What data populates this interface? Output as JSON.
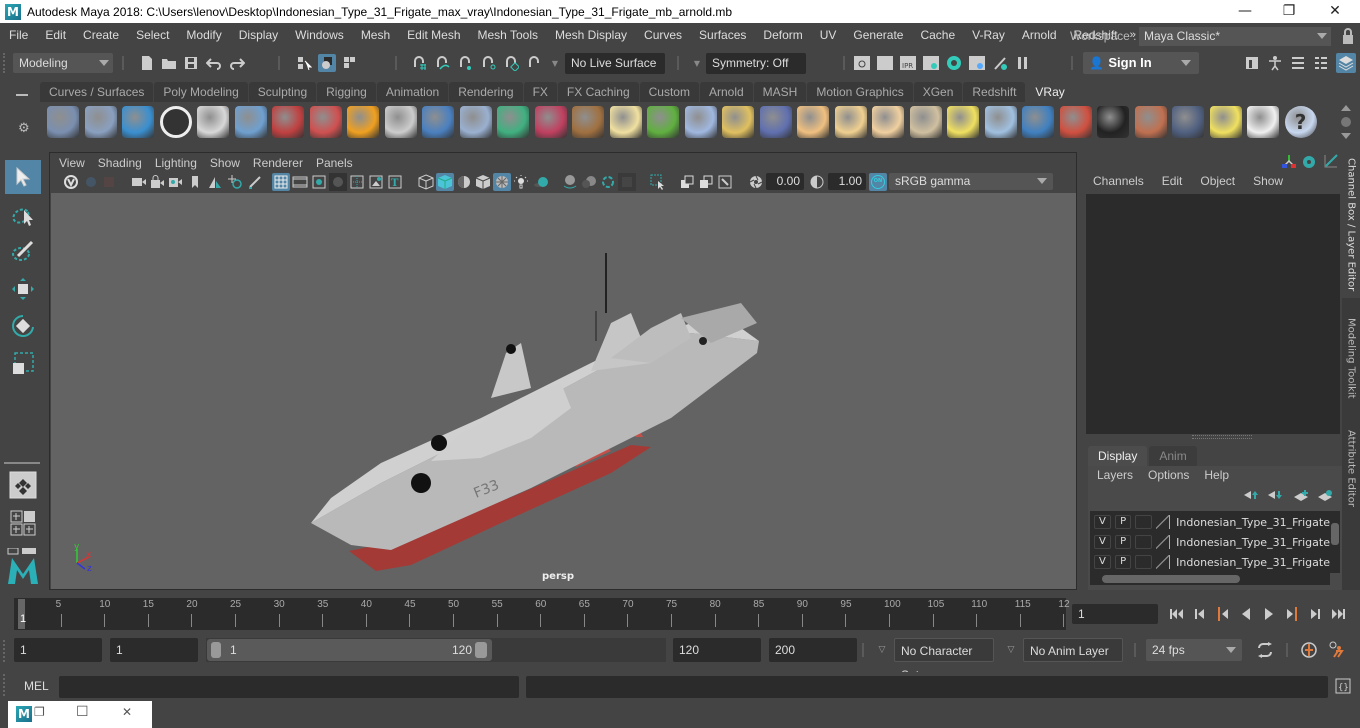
{
  "window": {
    "title": "Autodesk Maya 2018: C:\\Users\\lenov\\Desktop\\Indonesian_Type_31_Frigate_max_vray\\Indonesian_Type_31_Frigate_mb_arnold.mb",
    "logo": "M",
    "minimize": "—",
    "maximize": "❐",
    "close": "✕"
  },
  "menubar": {
    "items": [
      "File",
      "Edit",
      "Create",
      "Select",
      "Modify",
      "Display",
      "Windows",
      "Mesh",
      "Edit Mesh",
      "Mesh Tools",
      "Mesh Display",
      "Curves",
      "Surfaces",
      "Deform",
      "UV",
      "Generate",
      "Cache",
      "V-Ray",
      "Arnold",
      "Redshift"
    ],
    "overflow": "»",
    "workspace_label": "Workspace :",
    "workspace_value": "Maya Classic*"
  },
  "statusline": {
    "menuset": "Modeling",
    "live_surface": "No Live Surface",
    "symmetry": "Symmetry: Off",
    "sign_in": "Sign In"
  },
  "shelf": {
    "tabs": [
      "Curves / Surfaces",
      "Poly Modeling",
      "Sculpting",
      "Rigging",
      "Animation",
      "Rendering",
      "FX",
      "FX Caching",
      "Custom",
      "Arnold",
      "MASH",
      "Motion Graphics",
      "XGen",
      "Redshift",
      "VRay"
    ],
    "active_tab": "VRay",
    "icons": [
      "vray-export-icon",
      "vray-import-icon",
      "vray-proxy-list-icon",
      "vray-logo-icon",
      "vray-settings-doc-icon",
      "vray-dome-icon",
      "vray-camera-icon",
      "vray-material-spheres-icon",
      "vray-fire-icon",
      "vray-mesh-light-icon",
      "vray-rect-light-icon",
      "vray-cone-icon",
      "vray-volume-icon",
      "vray-fur-icon",
      "vray-texture-icon",
      "vray-sphere-grid-icon",
      "vray-grass-icon",
      "vray-scatter-icon",
      "vray-curve-icon",
      "vray-globe-icon",
      "vray-dome-light-icon",
      "vray-spot-light-icon",
      "vray-omni-light-icon",
      "vray-ies-light-icon",
      "vray-sun-icon",
      "vray-plane-icon",
      "vray-sphere-icon",
      "vray-multi-material-icon",
      "vray-checker-icon",
      "vray-frame-buffer-icon",
      "vray-settings-panel-icon",
      "vray-light-lister-icon",
      "vray-cloud-icon",
      "help-icon"
    ]
  },
  "panel": {
    "menus": [
      "View",
      "Shading",
      "Lighting",
      "Show",
      "Renderer",
      "Panels"
    ],
    "exposure": "0.00",
    "gamma": "1.00",
    "color_mgmt_badge": "ON",
    "color_space": "sRGB gamma",
    "camera_label": "persp",
    "ship_hull_number": "F33",
    "axis": {
      "x": "x",
      "y": "y",
      "z": "z"
    }
  },
  "channelbox": {
    "menus": [
      "Channels",
      "Edit",
      "Object",
      "Show"
    ],
    "layer_tabs": [
      "Display",
      "Anim"
    ],
    "layer_menus": [
      "Layers",
      "Options",
      "Help"
    ],
    "layers": [
      {
        "v": "V",
        "p": "P",
        "name": "Indonesian_Type_31_Frigate"
      },
      {
        "v": "V",
        "p": "P",
        "name": "Indonesian_Type_31_Frigate"
      },
      {
        "v": "V",
        "p": "P",
        "name": "Indonesian_Type_31_Frigate"
      }
    ]
  },
  "sidetabs": [
    "Channel Box / Layer Editor",
    "Modeling Toolkit",
    "Attribute Editor"
  ],
  "timeslider": {
    "ticks": [
      5,
      10,
      15,
      20,
      25,
      30,
      35,
      40,
      45,
      50,
      55,
      60,
      65,
      70,
      75,
      80,
      85,
      90,
      95,
      100,
      105,
      110,
      115,
      "12"
    ],
    "current_frame_marker": "1",
    "current_frame_field": "1"
  },
  "rangeslider": {
    "start_field": "1",
    "playback_start": "1",
    "range_min_label": "1",
    "range_max_label": "120",
    "playback_end": "120",
    "end_field": "200",
    "character_set": "No Character Set",
    "anim_layer": "No Anim Layer",
    "fps": "24 fps"
  },
  "cmdline": {
    "label": "MEL",
    "input_value": "",
    "result_value": ""
  },
  "minimized_window": {
    "logo": "M",
    "restore": "❐",
    "maximize": "☐",
    "close": "✕"
  },
  "colors": {
    "accent": "#5285a6",
    "background": "#444444",
    "field": "#2b2b2b",
    "viewport": "#636363",
    "key_orange": "#e07a3c"
  }
}
